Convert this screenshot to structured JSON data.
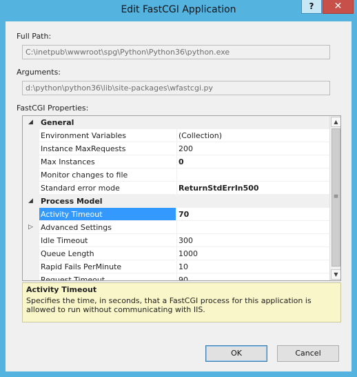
{
  "window": {
    "title": "Edit FastCGI Application",
    "help_label": "?",
    "close_label": "✕"
  },
  "form": {
    "full_path_label": "Full Path:",
    "full_path_value": "C:\\inetpub\\wwwroot\\spg\\Python\\Python36\\python.exe",
    "arguments_label": "Arguments:",
    "arguments_value": "d:\\python\\python36\\lib\\site-packages\\wfastcgi.py",
    "properties_label": "FastCGI Properties:"
  },
  "grid": {
    "rows": [
      {
        "type": "category",
        "expander": "◢",
        "name": "General"
      },
      {
        "type": "prop",
        "name": "Environment Variables",
        "value": "(Collection)",
        "bold": false
      },
      {
        "type": "prop",
        "name": "Instance MaxRequests",
        "value": "200",
        "bold": false
      },
      {
        "type": "prop",
        "name": "Max Instances",
        "value": "0",
        "bold": true
      },
      {
        "type": "prop",
        "name": "Monitor changes to file",
        "value": "",
        "bold": false
      },
      {
        "type": "prop",
        "name": "Standard error mode",
        "value": "ReturnStdErrIn500",
        "bold": true
      },
      {
        "type": "category",
        "expander": "◢",
        "name": "Process Model"
      },
      {
        "type": "prop",
        "name": "Activity Timeout",
        "value": "70",
        "bold": true,
        "selected": true
      },
      {
        "type": "prop",
        "name": "Advanced Settings",
        "value": "",
        "bold": false,
        "expander": "▷"
      },
      {
        "type": "prop",
        "name": "Idle Timeout",
        "value": "300",
        "bold": false
      },
      {
        "type": "prop",
        "name": "Queue Length",
        "value": "1000",
        "bold": false
      },
      {
        "type": "prop",
        "name": "Rapid Fails PerMinute",
        "value": "10",
        "bold": false
      },
      {
        "type": "prop",
        "name": "Request Timeout",
        "value": "90",
        "bold": false
      }
    ],
    "scroll_up": "▲",
    "scroll_down": "▼",
    "thumb_grip": "≡"
  },
  "description": {
    "title": "Activity Timeout",
    "text": "Specifies the time, in seconds, that a FastCGI process for this application is allowed to run without communicating with IIS."
  },
  "buttons": {
    "ok": "OK",
    "cancel": "Cancel"
  }
}
